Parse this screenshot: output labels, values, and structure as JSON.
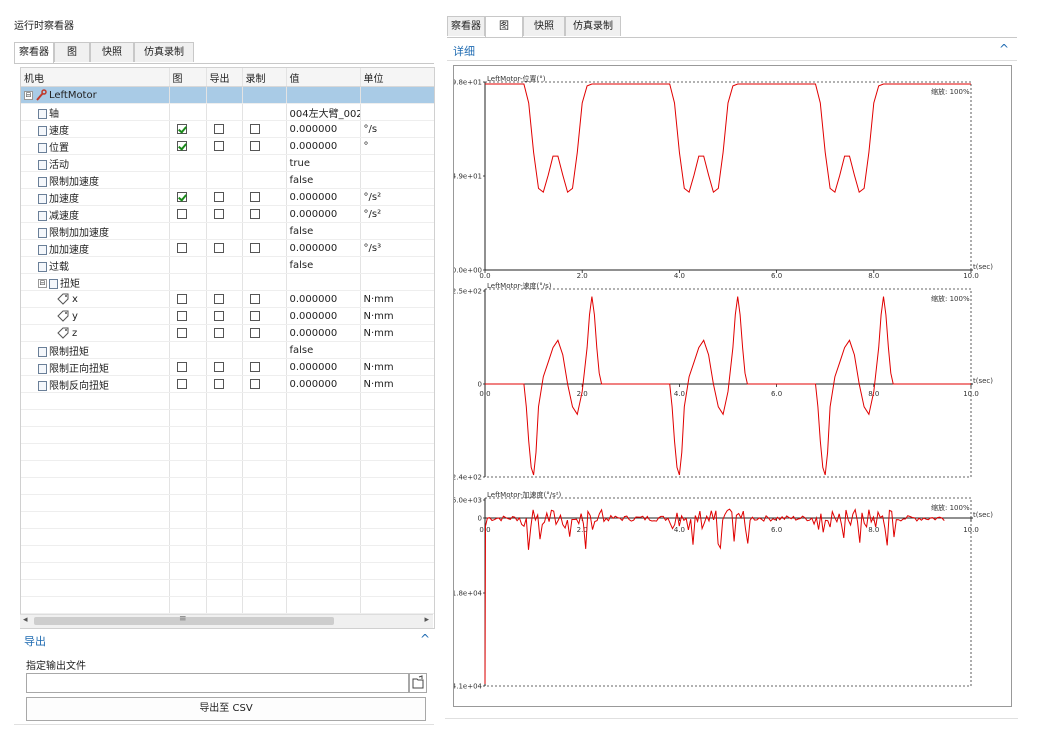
{
  "window_title": "运行时察看器",
  "left_tabs": [
    "察看器",
    "图",
    "快照",
    "仿真录制"
  ],
  "right_tabs": [
    "察看器",
    "图",
    "快照",
    "仿真录制"
  ],
  "table": {
    "headers": [
      "机电",
      "图",
      "导出",
      "录制",
      "值",
      "单位"
    ],
    "rows": [
      {
        "name": "LeftMotor",
        "level": 0,
        "kind": "motor",
        "expander": "⊟",
        "value": "",
        "unit": "",
        "has_checks": false,
        "selected": true
      },
      {
        "name": "轴",
        "level": 1,
        "kind": "prop",
        "value": "004左大臂_002...",
        "unit": "",
        "has_checks": false
      },
      {
        "name": "速度",
        "level": 1,
        "kind": "prop",
        "value": "0.000000",
        "unit": "°/s",
        "has_checks": true,
        "graph": true
      },
      {
        "name": "位置",
        "level": 1,
        "kind": "prop",
        "value": "0.000000",
        "unit": "°",
        "has_checks": true,
        "graph": true
      },
      {
        "name": "活动",
        "level": 1,
        "kind": "prop",
        "value": "true",
        "unit": "",
        "has_checks": false
      },
      {
        "name": "限制加速度",
        "level": 1,
        "kind": "prop",
        "value": "false",
        "unit": "",
        "has_checks": false
      },
      {
        "name": "加速度",
        "level": 1,
        "kind": "prop",
        "value": "0.000000",
        "unit": "°/s²",
        "has_checks": true,
        "graph": true
      },
      {
        "name": "减速度",
        "level": 1,
        "kind": "prop",
        "value": "0.000000",
        "unit": "°/s²",
        "has_checks": true,
        "graph": false
      },
      {
        "name": "限制加加速度",
        "level": 1,
        "kind": "prop",
        "value": "false",
        "unit": "",
        "has_checks": false
      },
      {
        "name": "加加速度",
        "level": 1,
        "kind": "prop",
        "value": "0.000000",
        "unit": "°/s³",
        "has_checks": true,
        "graph": false
      },
      {
        "name": "过载",
        "level": 1,
        "kind": "prop",
        "value": "false",
        "unit": "",
        "has_checks": false
      },
      {
        "name": "扭矩",
        "level": 1,
        "kind": "prop",
        "expander": "⊟",
        "value": "",
        "unit": "",
        "has_checks": false
      },
      {
        "name": "x",
        "level": 2,
        "kind": "tag",
        "value": "0.000000",
        "unit": "N·mm",
        "has_checks": true,
        "graph": false
      },
      {
        "name": "y",
        "level": 2,
        "kind": "tag",
        "value": "0.000000",
        "unit": "N·mm",
        "has_checks": true,
        "graph": false
      },
      {
        "name": "z",
        "level": 2,
        "kind": "tag",
        "value": "0.000000",
        "unit": "N·mm",
        "has_checks": true,
        "graph": false
      },
      {
        "name": "限制扭矩",
        "level": 1,
        "kind": "prop",
        "value": "false",
        "unit": "",
        "has_checks": false
      },
      {
        "name": "限制正向扭矩",
        "level": 1,
        "kind": "prop",
        "value": "0.000000",
        "unit": "N·mm",
        "has_checks": true,
        "graph": false
      },
      {
        "name": "限制反向扭矩",
        "level": 1,
        "kind": "prop",
        "value": "0.000000",
        "unit": "N·mm",
        "has_checks": true,
        "graph": false
      }
    ]
  },
  "scrollbar_glyphs": {
    "left": "◂",
    "right": "▸",
    "grip": "≡"
  },
  "export": {
    "title": "导出",
    "collapse_glyph": "^",
    "file_label": "指定输出文件",
    "file_value": "",
    "button_label": "导出至 CSV"
  },
  "detail": {
    "title": "详细",
    "collapse_glyph": "^"
  },
  "chart_data": [
    {
      "type": "line",
      "title": "LeftMotor-位置(°)",
      "zoom_label": "缩放: 100%",
      "x_unit_label": "t(sec)",
      "x_tick_labels": [
        "0.0",
        "2.0",
        "4.0",
        "6.0",
        "8.0",
        "10.0"
      ],
      "y_tick_labels": [
        "9.8e+01",
        "4.9e+01",
        "0.0e+00"
      ],
      "xlim": [
        0,
        10
      ],
      "ylim": [
        0,
        98
      ],
      "series_color": "#e00000",
      "x": [
        0.0,
        0.8,
        0.9,
        1.0,
        1.1,
        1.2,
        1.3,
        1.4,
        1.5,
        1.6,
        1.7,
        1.8,
        1.9,
        2.0,
        2.1,
        2.2,
        2.3,
        2.4,
        3.8,
        3.9,
        4.0,
        4.1,
        4.2,
        4.3,
        4.4,
        4.5,
        4.6,
        4.7,
        4.8,
        4.9,
        5.0,
        5.1,
        5.2,
        5.3,
        5.4,
        6.8,
        6.9,
        7.0,
        7.1,
        7.2,
        7.3,
        7.4,
        7.5,
        7.6,
        7.7,
        7.8,
        7.9,
        8.0,
        8.1,
        8.2,
        8.3,
        8.4,
        10.0
      ],
      "y": [
        98,
        98,
        88,
        62,
        43,
        41,
        50,
        60,
        60,
        50,
        41,
        43,
        62,
        88,
        97,
        98,
        98,
        98,
        98,
        88,
        62,
        43,
        41,
        50,
        60,
        60,
        50,
        41,
        43,
        62,
        88,
        97,
        98,
        98,
        98,
        98,
        88,
        62,
        43,
        41,
        50,
        60,
        60,
        50,
        41,
        43,
        62,
        88,
        97,
        98,
        98,
        98,
        98
      ]
    },
    {
      "type": "line",
      "title": "LeftMotor-速度(°/s)",
      "zoom_label": "缩放: 100%",
      "x_unit_label": "t(sec)",
      "x_tick_labels": [
        "0.0",
        "2.0",
        "4.0",
        "6.0",
        "8.0",
        "10.0"
      ],
      "y_tick_labels": [
        "2.5e+02",
        "0",
        "-2.4e+02"
      ],
      "xlim": [
        0,
        10
      ],
      "ylim": [
        -240,
        250
      ],
      "series_color": "#e00000",
      "x": [
        0.0,
        0.8,
        0.85,
        0.9,
        0.95,
        1.0,
        1.05,
        1.1,
        1.2,
        1.3,
        1.4,
        1.5,
        1.6,
        1.7,
        1.8,
        1.9,
        2.0,
        2.1,
        2.15,
        2.2,
        2.25,
        2.3,
        2.35,
        2.4,
        3.8,
        3.85,
        3.9,
        3.95,
        4.0,
        4.05,
        4.1,
        4.2,
        4.3,
        4.4,
        4.5,
        4.6,
        4.7,
        4.8,
        4.9,
        5.0,
        5.1,
        5.15,
        5.2,
        5.25,
        5.3,
        5.35,
        5.4,
        6.8,
        6.85,
        6.9,
        6.95,
        7.0,
        7.05,
        7.1,
        7.2,
        7.3,
        7.4,
        7.5,
        7.6,
        7.7,
        7.8,
        7.9,
        8.0,
        8.1,
        8.15,
        8.2,
        8.25,
        8.3,
        8.35,
        8.4,
        10.0
      ],
      "y": [
        0,
        0,
        -60,
        -150,
        -220,
        -240,
        -180,
        -60,
        20,
        60,
        100,
        120,
        80,
        0,
        -60,
        -80,
        -20,
        100,
        190,
        240,
        190,
        100,
        30,
        0,
        0,
        -60,
        -150,
        -220,
        -240,
        -180,
        -60,
        20,
        60,
        100,
        120,
        80,
        0,
        -60,
        -80,
        -20,
        100,
        190,
        240,
        190,
        100,
        30,
        0,
        0,
        -60,
        -150,
        -220,
        -240,
        -180,
        -60,
        20,
        60,
        100,
        120,
        80,
        0,
        -60,
        -80,
        -20,
        100,
        190,
        240,
        190,
        100,
        30,
        0,
        0
      ]
    },
    {
      "type": "line",
      "title": "LeftMotor-加速度(°/s²)",
      "zoom_label": "缩放: 100%",
      "x_unit_label": "t(sec)",
      "x_tick_labels": [
        "0.0",
        "2.0",
        "4.0",
        "6.0",
        "8.0",
        "10.0"
      ],
      "y_tick_labels": [
        "6.0e+03",
        "0",
        "-1.8e+04",
        "-4.1e+04"
      ],
      "xlim": [
        0,
        10
      ],
      "ylim": [
        -41000,
        6000
      ],
      "series_color": "#e00000"
    }
  ]
}
